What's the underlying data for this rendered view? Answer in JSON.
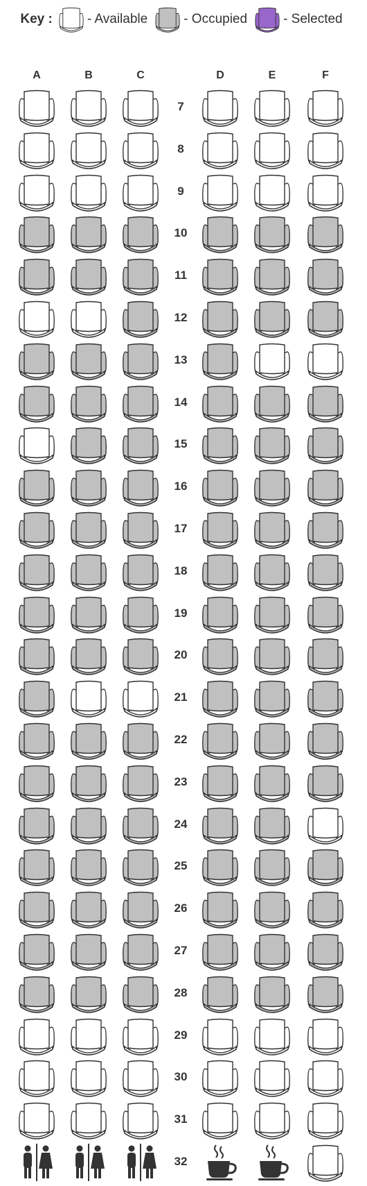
{
  "key": {
    "label": "Key :",
    "available": "- Available",
    "occupied": "- Occupied",
    "selected": "- Selected"
  },
  "colors": {
    "available_fill": "#ffffff",
    "occupied_fill": "#c0c0c0",
    "selected_fill": "#9966cc",
    "outline": "#333333"
  },
  "columns": [
    "A",
    "B",
    "C",
    "D",
    "E",
    "F"
  ],
  "rows": [
    {
      "num": "7",
      "seats": [
        "available",
        "available",
        "available",
        "available",
        "available",
        "available"
      ]
    },
    {
      "num": "8",
      "seats": [
        "available",
        "available",
        "available",
        "available",
        "available",
        "available"
      ]
    },
    {
      "num": "9",
      "seats": [
        "available",
        "available",
        "available",
        "available",
        "available",
        "available"
      ]
    },
    {
      "num": "10",
      "seats": [
        "occupied",
        "occupied",
        "occupied",
        "occupied",
        "occupied",
        "occupied"
      ]
    },
    {
      "num": "11",
      "seats": [
        "occupied",
        "occupied",
        "occupied",
        "occupied",
        "occupied",
        "occupied"
      ]
    },
    {
      "num": "12",
      "seats": [
        "available",
        "available",
        "occupied",
        "occupied",
        "occupied",
        "occupied"
      ]
    },
    {
      "num": "13",
      "seats": [
        "occupied",
        "occupied",
        "occupied",
        "occupied",
        "available",
        "available"
      ]
    },
    {
      "num": "14",
      "seats": [
        "occupied",
        "occupied",
        "occupied",
        "occupied",
        "occupied",
        "occupied"
      ]
    },
    {
      "num": "15",
      "seats": [
        "available",
        "occupied",
        "occupied",
        "occupied",
        "occupied",
        "occupied"
      ]
    },
    {
      "num": "16",
      "seats": [
        "occupied",
        "occupied",
        "occupied",
        "occupied",
        "occupied",
        "occupied"
      ]
    },
    {
      "num": "17",
      "seats": [
        "occupied",
        "occupied",
        "occupied",
        "occupied",
        "occupied",
        "occupied"
      ]
    },
    {
      "num": "18",
      "seats": [
        "occupied",
        "occupied",
        "occupied",
        "occupied",
        "occupied",
        "occupied"
      ]
    },
    {
      "num": "19",
      "seats": [
        "occupied",
        "occupied",
        "occupied",
        "occupied",
        "occupied",
        "occupied"
      ]
    },
    {
      "num": "20",
      "seats": [
        "occupied",
        "occupied",
        "occupied",
        "occupied",
        "occupied",
        "occupied"
      ]
    },
    {
      "num": "21",
      "seats": [
        "occupied",
        "available",
        "available",
        "occupied",
        "occupied",
        "occupied"
      ]
    },
    {
      "num": "22",
      "seats": [
        "occupied",
        "occupied",
        "occupied",
        "occupied",
        "occupied",
        "occupied"
      ]
    },
    {
      "num": "23",
      "seats": [
        "occupied",
        "occupied",
        "occupied",
        "occupied",
        "occupied",
        "occupied"
      ]
    },
    {
      "num": "24",
      "seats": [
        "occupied",
        "occupied",
        "occupied",
        "occupied",
        "occupied",
        "available"
      ]
    },
    {
      "num": "25",
      "seats": [
        "occupied",
        "occupied",
        "occupied",
        "occupied",
        "occupied",
        "occupied"
      ]
    },
    {
      "num": "26",
      "seats": [
        "occupied",
        "occupied",
        "occupied",
        "occupied",
        "occupied",
        "occupied"
      ]
    },
    {
      "num": "27",
      "seats": [
        "occupied",
        "occupied",
        "occupied",
        "occupied",
        "occupied",
        "occupied"
      ]
    },
    {
      "num": "28",
      "seats": [
        "occupied",
        "occupied",
        "occupied",
        "occupied",
        "occupied",
        "occupied"
      ]
    },
    {
      "num": "29",
      "seats": [
        "available",
        "available",
        "available",
        "available",
        "available",
        "available"
      ]
    },
    {
      "num": "30",
      "seats": [
        "available",
        "available",
        "available",
        "available",
        "available",
        "available"
      ]
    },
    {
      "num": "31",
      "seats": [
        "available",
        "available",
        "available",
        "available",
        "available",
        "available"
      ]
    },
    {
      "num": "32",
      "seats": [
        "lavatory-icon",
        "lavatory-icon",
        "lavatory-icon",
        "galley-coffee-icon",
        "galley-coffee-icon",
        "available"
      ]
    }
  ]
}
